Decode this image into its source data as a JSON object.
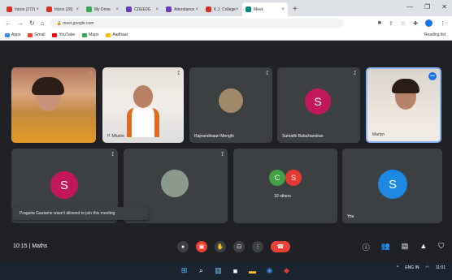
{
  "browser": {
    "tabs": [
      {
        "label": "Inbox (272)",
        "color": "#d93025"
      },
      {
        "label": "Inbox (28)",
        "color": "#d93025"
      },
      {
        "label": "My Drive",
        "color": "#34a853"
      },
      {
        "label": "CDEE0G",
        "color": "#673ab7"
      },
      {
        "label": "Attendance",
        "color": "#673ab7"
      },
      {
        "label": "K.J. College",
        "color": "#d93025"
      },
      {
        "label": "Meet",
        "color": "#00897b"
      }
    ],
    "new_tab": "+",
    "url": "meet.google.com",
    "bookmarks": [
      {
        "label": "Apps",
        "color": "#4285f4"
      },
      {
        "label": "Gmail",
        "color": "#ea4335"
      },
      {
        "label": "YouTube",
        "color": "#ff0000"
      },
      {
        "label": "Maps",
        "color": "#34a853"
      },
      {
        "label": "Aadhaar",
        "color": "#fbbc04"
      }
    ],
    "reading_list": "Reading list"
  },
  "tiles": [
    {
      "name": "",
      "type": "video1"
    },
    {
      "name": "P. Mhatre",
      "type": "video2"
    },
    {
      "name": "Rajnandinaari Menghi",
      "type": "photo"
    },
    {
      "name": "Sumathi Balachandran",
      "type": "avatar",
      "letter": "S",
      "color": "#c2185b"
    },
    {
      "name": "Marlyn",
      "type": "video3"
    },
    {
      "name": "",
      "type": "avatar",
      "letter": "S",
      "color": "#c2185b"
    },
    {
      "name": "",
      "type": "photo2"
    },
    {
      "name": "10 others",
      "type": "group"
    },
    {
      "name": "You",
      "type": "avatar",
      "letter": "S",
      "color": "#1e88e5"
    }
  ],
  "group_avatars": [
    {
      "letter": "C",
      "color": "#43a047"
    },
    {
      "letter": "S",
      "color": "#e53935"
    }
  ],
  "toast": "Pragatia Gautame wasn't allowed to join this meeting",
  "meeting": {
    "time": "10:15",
    "code": "Maths"
  },
  "taskbar": {
    "time": "11:01",
    "date": "ENG IN"
  }
}
